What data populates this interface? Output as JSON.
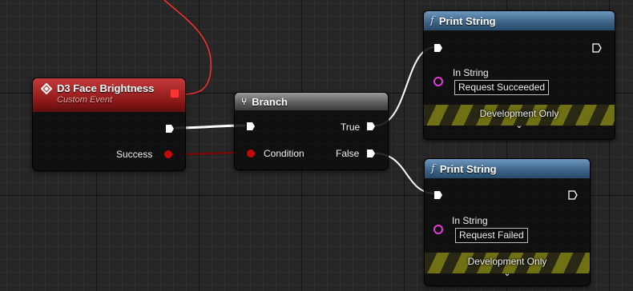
{
  "event_node": {
    "title": "D3 Face Brightness",
    "subtitle": "Custom Event",
    "output_pin_label": "Success"
  },
  "branch_node": {
    "title": "Branch",
    "input_pin_label": "Condition",
    "true_label": "True",
    "false_label": "False"
  },
  "print_nodes": [
    {
      "title": "Print String",
      "in_string_label": "In String",
      "in_string_value": "Request Succeeded",
      "dev_label": "Development Only"
    },
    {
      "title": "Print String",
      "in_string_label": "In String",
      "in_string_value": "Request Failed",
      "dev_label": "Development Only"
    }
  ],
  "colors": {
    "exec_wire": "#ffffff",
    "bool_wire": "#8b0000",
    "event_wire": "#ff3030",
    "bool_pin": "#c10a0a",
    "string_pin": "#e43ad8"
  }
}
